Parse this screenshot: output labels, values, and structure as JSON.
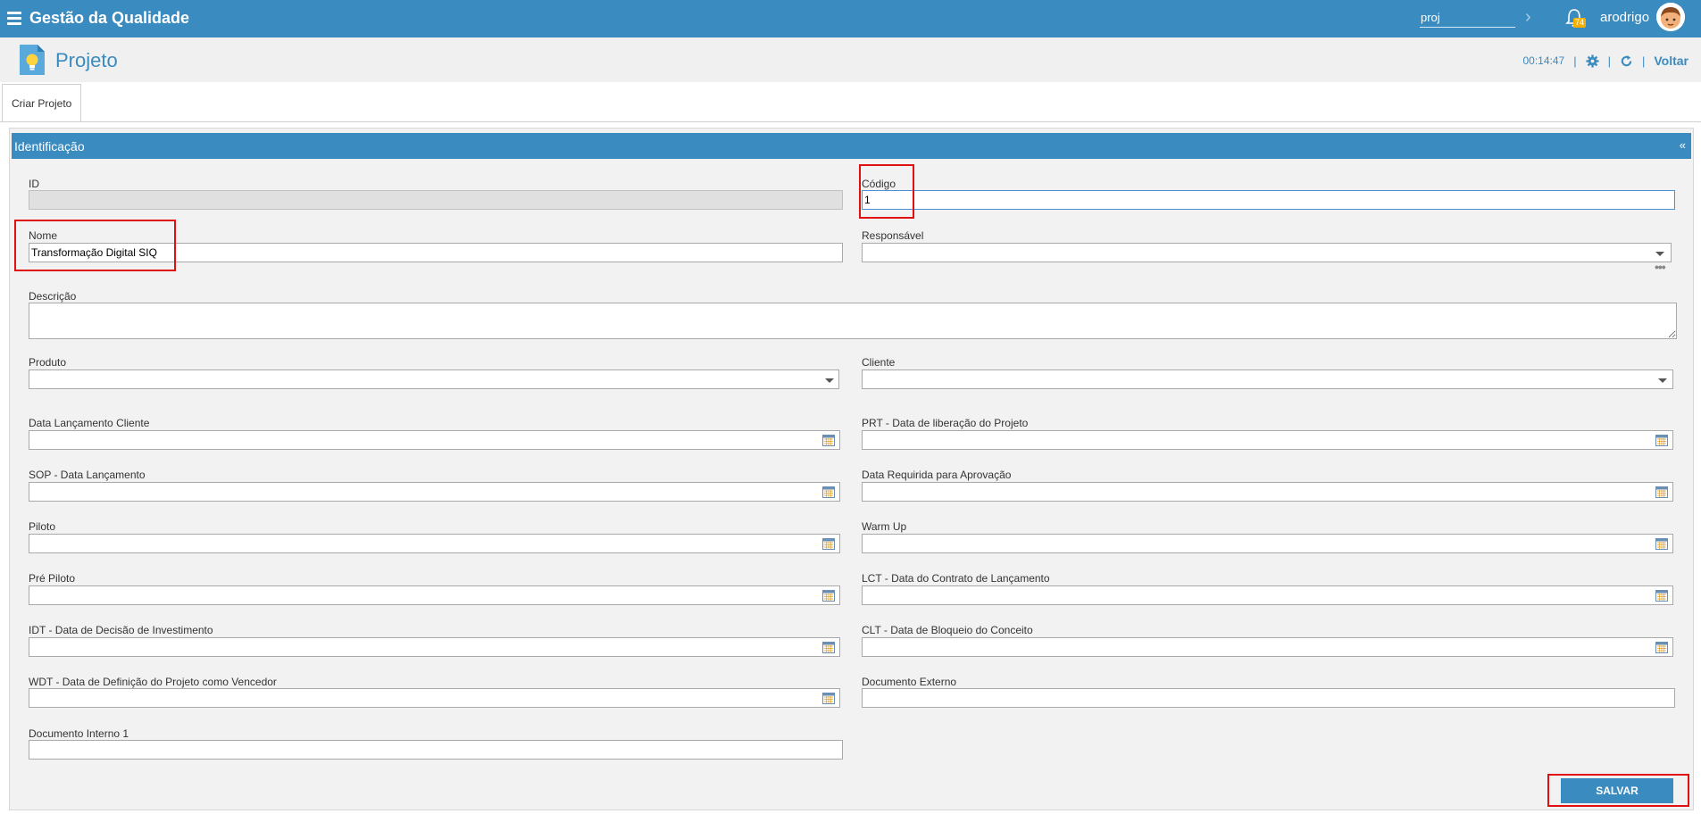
{
  "topbar": {
    "app_title": "Gestão da Qualidade",
    "search_value": "proj",
    "notification_count": "74",
    "username": "arodrigo"
  },
  "page": {
    "title": "Projeto",
    "timer": "00:14:47",
    "back_label": "Voltar"
  },
  "tabs": [
    {
      "label": "Criar Projeto"
    }
  ],
  "panel": {
    "title": "Identificação",
    "collapse_glyph": "«"
  },
  "form": {
    "id": {
      "label": "ID",
      "value": ""
    },
    "codigo": {
      "label": "Código",
      "value": "1"
    },
    "nome": {
      "label": "Nome",
      "value": "Transformação Digital SIQ"
    },
    "responsavel": {
      "label": "Responsável",
      "value": ""
    },
    "descricao": {
      "label": "Descrição",
      "value": ""
    },
    "produto": {
      "label": "Produto",
      "value": ""
    },
    "cliente": {
      "label": "Cliente",
      "value": ""
    },
    "data_lancamento_cliente": {
      "label": "Data Lançamento Cliente",
      "value": ""
    },
    "prt": {
      "label": "PRT - Data de liberação do Projeto",
      "value": ""
    },
    "sop": {
      "label": "SOP - Data Lançamento",
      "value": ""
    },
    "data_requerida": {
      "label": "Data Requirida para Aprovação",
      "value": ""
    },
    "piloto": {
      "label": "Piloto",
      "value": ""
    },
    "warm_up": {
      "label": "Warm Up",
      "value": ""
    },
    "pre_piloto": {
      "label": "Pré Piloto",
      "value": ""
    },
    "lct": {
      "label": "LCT - Data do Contrato de Lançamento",
      "value": ""
    },
    "idt": {
      "label": "IDT - Data de Decisão de Investimento",
      "value": ""
    },
    "clt": {
      "label": "CLT - Data de Bloqueio do Conceito",
      "value": ""
    },
    "wdt": {
      "label": "WDT - Data de Definição do Projeto como Vencedor",
      "value": ""
    },
    "documento_externo": {
      "label": "Documento Externo",
      "value": ""
    },
    "documento_interno_1": {
      "label": "Documento Interno 1",
      "value": ""
    }
  },
  "actions": {
    "save_label": "SALVAR"
  },
  "colors": {
    "brand": "#3a8bc0",
    "highlight": "#e01010"
  }
}
